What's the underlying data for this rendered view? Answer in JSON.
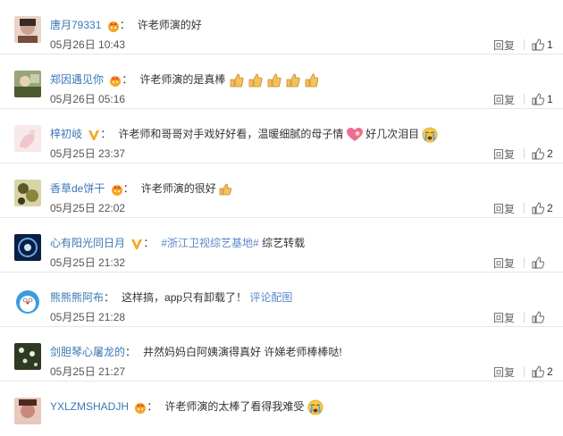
{
  "comments": [
    {
      "user": "唐月79331",
      "badge": "crown",
      "text": "许老师演的好",
      "time": "05月26日 10:43",
      "reply": "回复",
      "likes": "1",
      "avatar_color": "#c9a48f"
    },
    {
      "user": "郑因遇见你",
      "badge": "crown",
      "text": "许老师演的是真棒",
      "emojis": 5,
      "time": "05月26日 05:16",
      "reply": "回复",
      "likes": "1",
      "avatar_color": "#6b7a4f"
    },
    {
      "user": "梓初岐",
      "badge": "vip",
      "text": "许老师和哥哥对手戏好好看，温暖细腻的母子情",
      "text2": "好几次泪目",
      "time": "05月25日 23:37",
      "reply": "回复",
      "likes": "2",
      "avatar_color": "#f0d6d9"
    },
    {
      "user": "香草de饼干",
      "badge": "crown",
      "text": "许老师演的很好",
      "time": "05月25日 22:02",
      "reply": "回复",
      "likes": "2",
      "avatar_color": "#7b7a45"
    },
    {
      "user": "心有阳光同日月",
      "badge": "vip",
      "link": "#浙江卫视综艺基地#",
      "text": "综艺转载",
      "time": "05月25日 21:32",
      "reply": "回复",
      "likes": "",
      "avatar_color": "#0e2a5a"
    },
    {
      "user": "熊熊熊阿布",
      "badge": "none",
      "text": "这样搞，app只有卸载了！",
      "link2": "评论配图",
      "time": "05月25日 21:28",
      "reply": "回复",
      "likes": "",
      "avatar_color": "#4aa0e0"
    },
    {
      "user": "剑胆琴心屠龙的",
      "badge": "none",
      "text": "井然妈妈白阿姨演得真好 许娣老师棒棒哒!",
      "time": "05月25日 21:27",
      "reply": "回复",
      "likes": "2",
      "avatar_color": "#3c4a2e"
    },
    {
      "user": "YXLZMSHADJH",
      "badge": "crown",
      "text": "许老师演的太棒了看得我难受",
      "time": "",
      "reply": "",
      "likes": "",
      "avatar_color": "#c88a7a"
    }
  ]
}
